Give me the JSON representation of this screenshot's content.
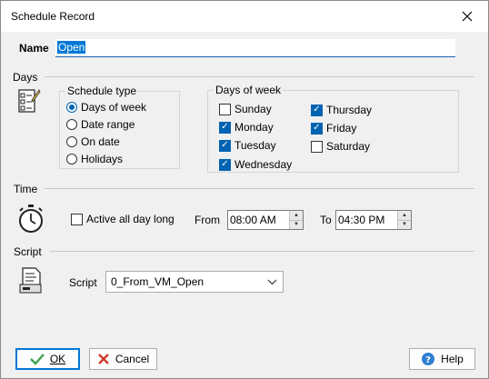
{
  "window": {
    "title": "Schedule Record"
  },
  "name": {
    "label": "Name",
    "value": "Open"
  },
  "days": {
    "section_label": "Days",
    "icon": "calendar-checklist-icon",
    "schedule_type": {
      "title": "Schedule type",
      "options": [
        "Days of week",
        "Date range",
        "On date",
        "Holidays"
      ],
      "selected": "Days of week"
    },
    "days_of_week": {
      "title": "Days of week",
      "days": [
        {
          "label": "Sunday",
          "checked": false
        },
        {
          "label": "Monday",
          "checked": true
        },
        {
          "label": "Tuesday",
          "checked": true
        },
        {
          "label": "Wednesday",
          "checked": true
        },
        {
          "label": "Thursday",
          "checked": true
        },
        {
          "label": "Friday",
          "checked": true
        },
        {
          "label": "Saturday",
          "checked": false
        }
      ]
    }
  },
  "time": {
    "section_label": "Time",
    "icon": "stopwatch-icon",
    "all_day_label": "Active all day long",
    "all_day_checked": false,
    "from_label": "From",
    "from_value": "08:00 AM",
    "to_label": "To",
    "to_value": "04:30 PM"
  },
  "script": {
    "section_label": "Script",
    "icon": "script-document-icon",
    "field_label": "Script",
    "value": "0_From_VM_Open"
  },
  "buttons": {
    "ok": "OK",
    "cancel": "Cancel",
    "help": "Help"
  },
  "colors": {
    "accent": "#0063b1",
    "selection": "#0078d7"
  }
}
